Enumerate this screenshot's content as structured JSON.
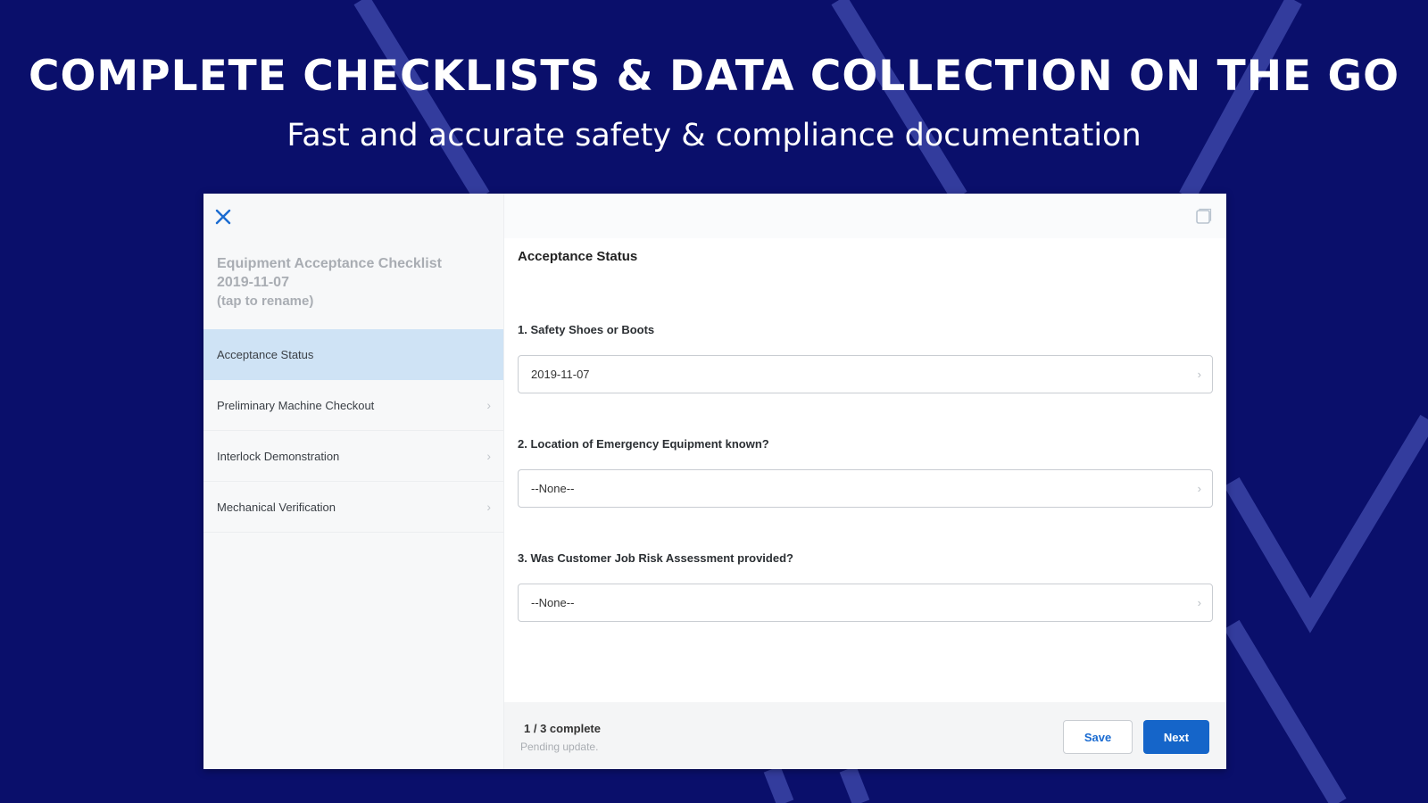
{
  "banner": {
    "headline": "COMPLETE CHECKLISTS & DATA COLLECTION ON THE GO",
    "subheadline": "Fast and accurate safety & compliance documentation"
  },
  "colors": {
    "background": "#0a0f6b",
    "accent_line": "#4a55b8",
    "active_nav": "#cfe3f5",
    "primary_button": "#1565c9"
  },
  "sidebar": {
    "doc_title_line1": "Equipment Acceptance Checklist",
    "doc_title_line2": "2019-11-07",
    "doc_title_hint": "(tap to rename)",
    "close_icon": "close-icon",
    "items": [
      {
        "label": "Acceptance Status",
        "active": true
      },
      {
        "label": "Preliminary Machine Checkout",
        "active": false
      },
      {
        "label": "Interlock Demonstration",
        "active": false
      },
      {
        "label": "Mechanical Verification",
        "active": false
      }
    ]
  },
  "main": {
    "expand_icon": "expand-icon",
    "section_title": "Acceptance Status",
    "questions": [
      {
        "label": "1. Safety Shoes or Boots",
        "value": "2019-11-07"
      },
      {
        "label": "2. Location of Emergency Equipment known?",
        "value": "--None--"
      },
      {
        "label": "3. Was Customer Job Risk Assessment provided?",
        "value": "--None--"
      }
    ]
  },
  "footer": {
    "progress": "1 / 3  complete",
    "status": "Pending update.",
    "save_label": "Save",
    "next_label": "Next"
  }
}
